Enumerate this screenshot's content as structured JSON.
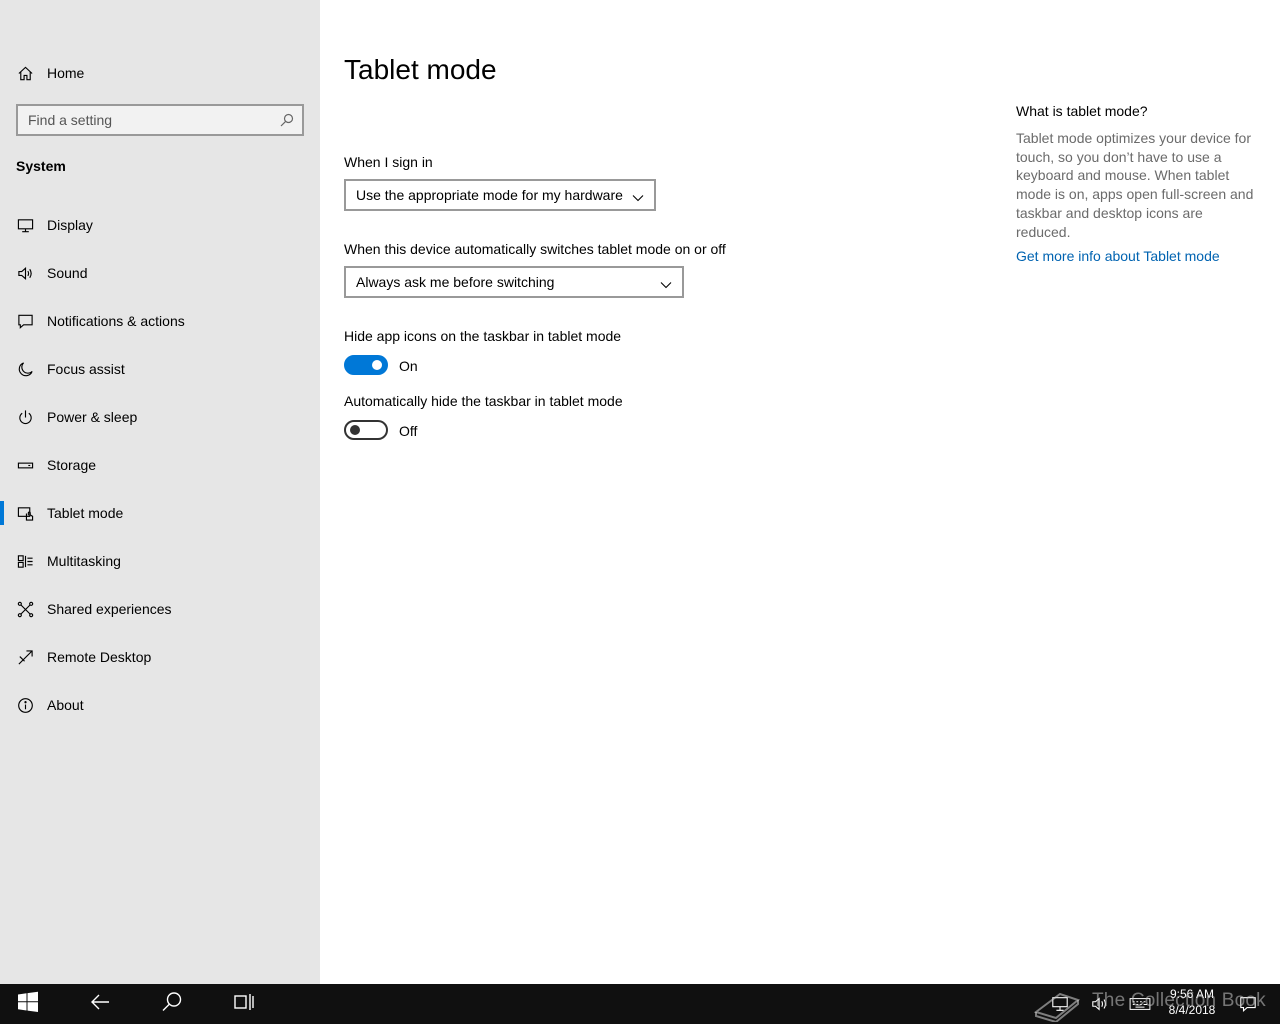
{
  "sidebar": {
    "home_label": "Home",
    "search_placeholder": "Find a setting",
    "section_title": "System",
    "items": [
      {
        "label": "Display",
        "icon": "monitor-icon"
      },
      {
        "label": "Sound",
        "icon": "speaker-icon"
      },
      {
        "label": "Notifications & actions",
        "icon": "message-icon"
      },
      {
        "label": "Focus assist",
        "icon": "moon-icon"
      },
      {
        "label": "Power & sleep",
        "icon": "power-icon"
      },
      {
        "label": "Storage",
        "icon": "storage-drive-icon"
      },
      {
        "label": "Tablet mode",
        "icon": "tablet-mode-icon",
        "selected": true
      },
      {
        "label": "Multitasking",
        "icon": "multitasking-icon"
      },
      {
        "label": "Shared experiences",
        "icon": "shared-experiences-icon"
      },
      {
        "label": "Remote Desktop",
        "icon": "remote-desktop-icon"
      },
      {
        "label": "About",
        "icon": "info-icon"
      }
    ]
  },
  "main": {
    "title": "Tablet mode",
    "sign_in_label": "When I sign in",
    "sign_in_value": "Use the appropriate mode for my hardware",
    "switch_label": "When this device automatically switches tablet mode on or off",
    "switch_value": "Always ask me before switching",
    "hide_icons_label": "Hide app icons on the taskbar in tablet mode",
    "hide_icons_state": "On",
    "hide_icons_on": true,
    "hide_taskbar_label": "Automatically hide the taskbar in tablet mode",
    "hide_taskbar_state": "Off",
    "hide_taskbar_on": false
  },
  "help": {
    "title": "What is tablet mode?",
    "text": "Tablet mode optimizes your device for touch, so you don’t have to use a keyboard and mouse. When tablet mode is on, apps open full-screen and taskbar and desktop icons are reduced.",
    "link": "Get more info about Tablet mode"
  },
  "taskbar": {
    "time": "9:56 AM",
    "date": "8/4/2018",
    "watermark": "The Collection Book"
  },
  "colors": {
    "accent": "#0078d7",
    "sidebar_bg": "#e6e6e6",
    "taskbar_bg": "#101010",
    "link": "#0063b1"
  }
}
